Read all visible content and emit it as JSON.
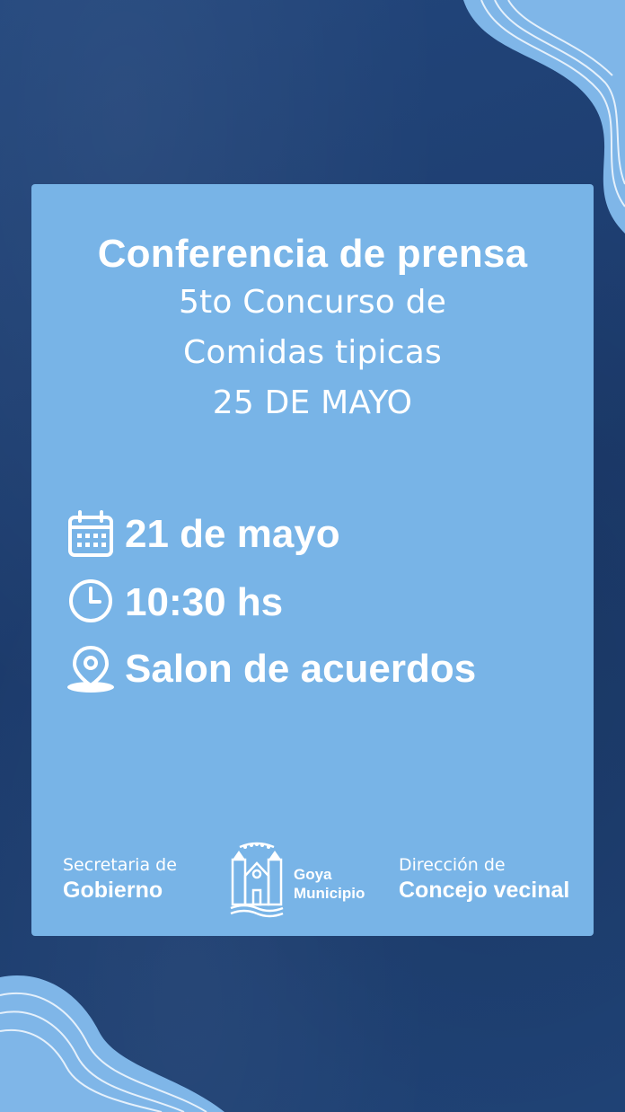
{
  "card": {
    "title": "Conferencia de prensa",
    "subtitle_lines": [
      "5to Concurso de",
      "Comidas tipicas",
      "25 DE  MAYO"
    ]
  },
  "details": {
    "date": {
      "icon": "calendar-icon",
      "text": "21 de mayo"
    },
    "time": {
      "icon": "clock-icon",
      "text": "10:30 hs"
    },
    "place": {
      "icon": "location-pin-icon",
      "text": "Salon de acuerdos"
    }
  },
  "footer": {
    "left": {
      "line1": "Secretaria de",
      "line2": "Gobierno"
    },
    "logo": {
      "icon": "church-emblem-icon",
      "line1": "Goya",
      "line2": "Municipio"
    },
    "right": {
      "line1": "Dirección de",
      "line2": "Concejo vecinal"
    }
  },
  "colors": {
    "background": "#1e3f72",
    "card": "#78b4e7",
    "wave": "#7fb6e8",
    "text": "#ffffff"
  }
}
